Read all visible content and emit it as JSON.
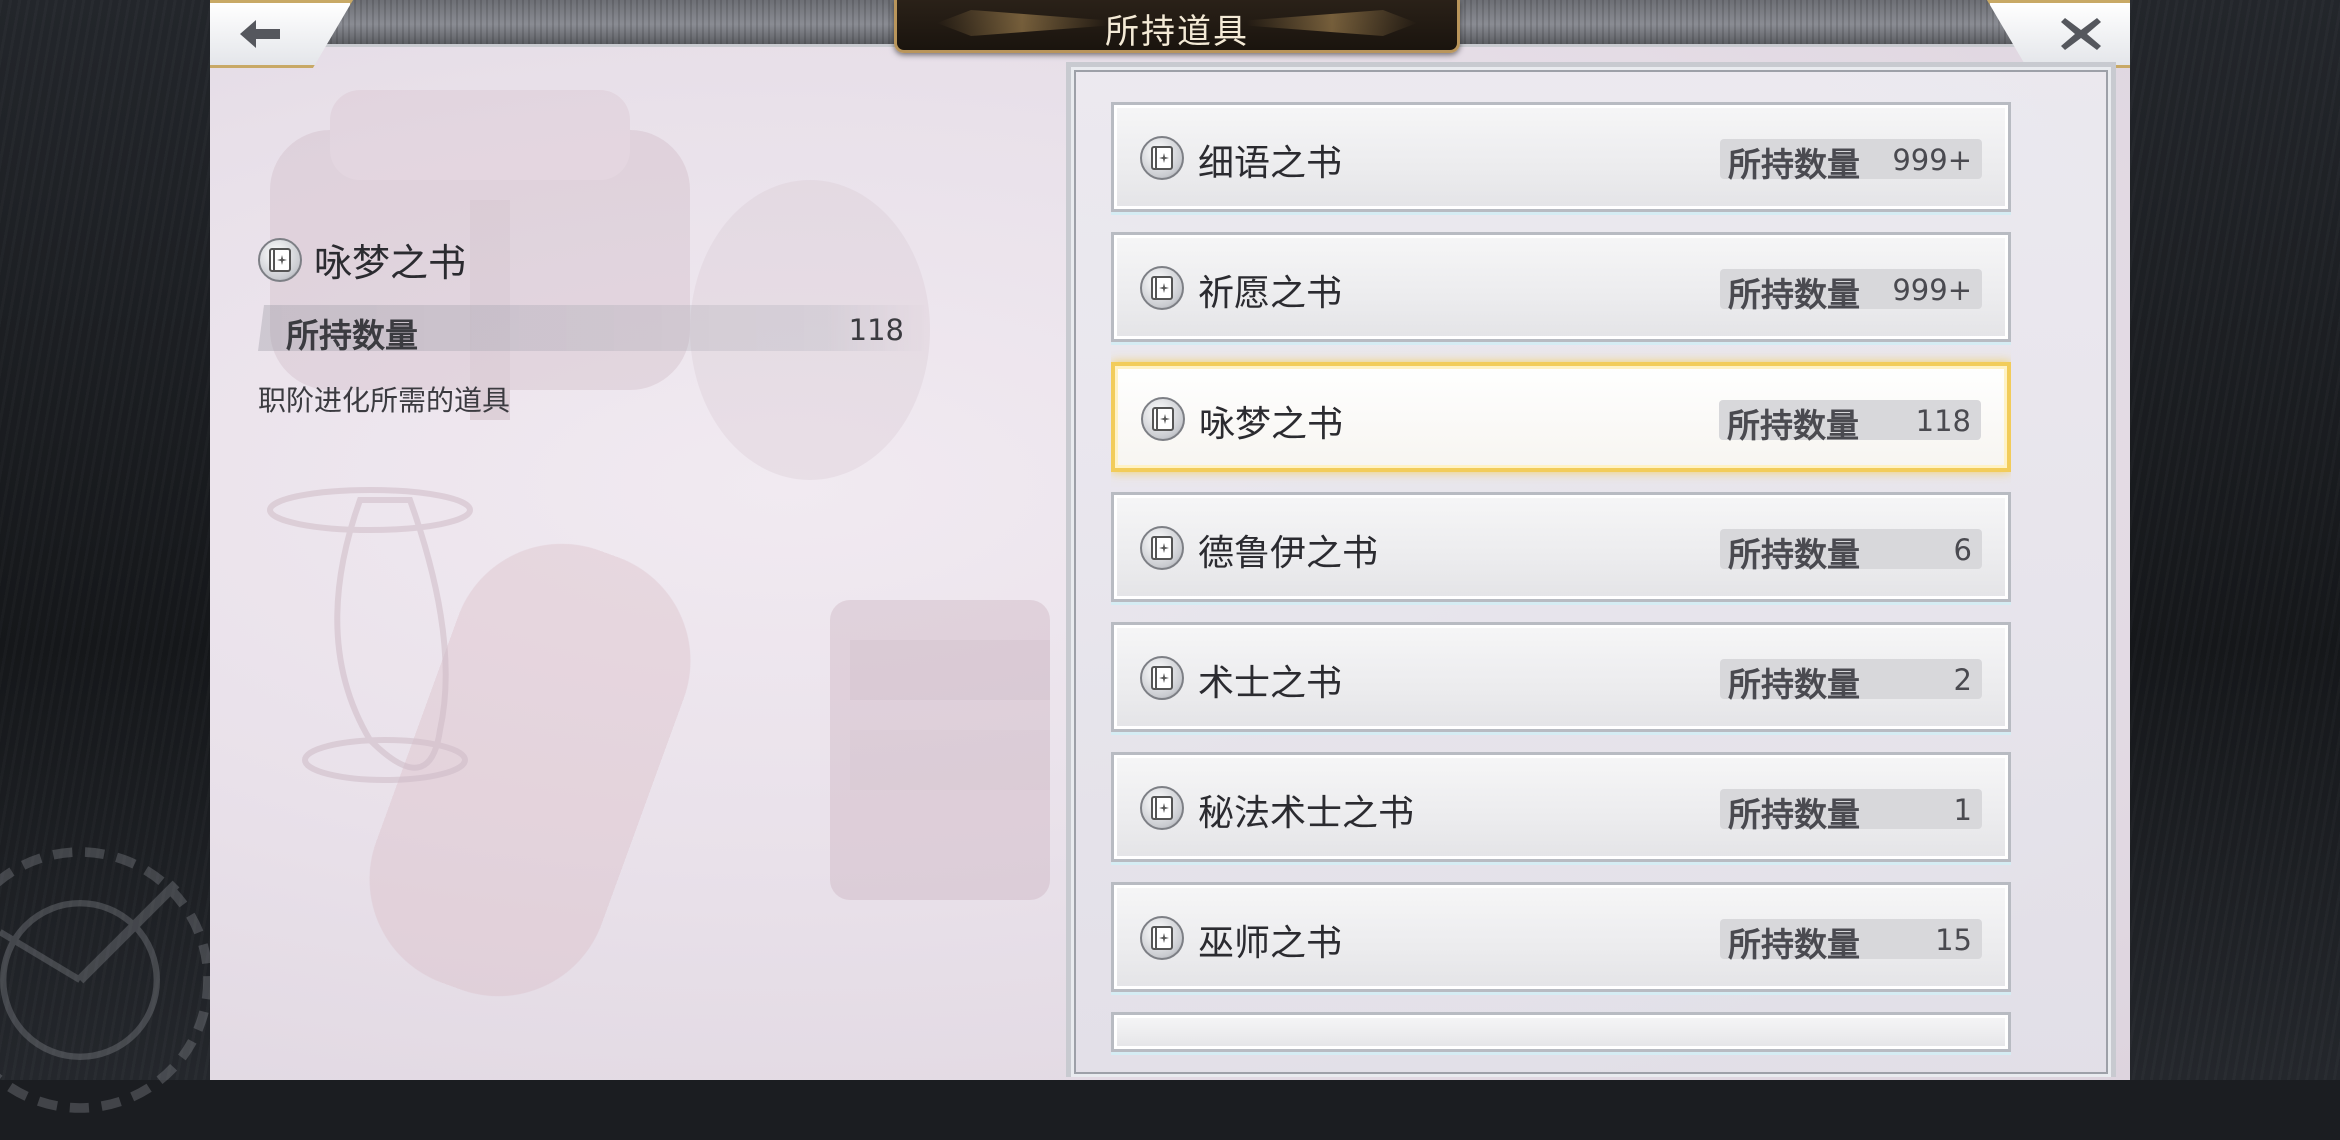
{
  "header": {
    "title": "所持道具",
    "back_icon": "back-arrow-icon",
    "close_icon": "close-icon"
  },
  "detail": {
    "name": "咏梦之书",
    "qty_label": "所持数量",
    "qty_value": "118",
    "description": "职阶进化所需的道具"
  },
  "items": [
    {
      "name": "细语之书",
      "qty_label": "所持数量",
      "qty": "999+",
      "selected": false
    },
    {
      "name": "祈愿之书",
      "qty_label": "所持数量",
      "qty": "999+",
      "selected": false
    },
    {
      "name": "咏梦之书",
      "qty_label": "所持数量",
      "qty": "118",
      "selected": true
    },
    {
      "name": "德鲁伊之书",
      "qty_label": "所持数量",
      "qty": "6",
      "selected": false
    },
    {
      "name": "术士之书",
      "qty_label": "所持数量",
      "qty": "2",
      "selected": false
    },
    {
      "name": "秘法术士之书",
      "qty_label": "所持数量",
      "qty": "1",
      "selected": false
    },
    {
      "name": "巫师之书",
      "qty_label": "所持数量",
      "qty": "15",
      "selected": false
    }
  ],
  "colors": {
    "selected_border": "#f2cc5a",
    "title_plate": "#1a140e",
    "title_plate_border": "#b9955b"
  }
}
